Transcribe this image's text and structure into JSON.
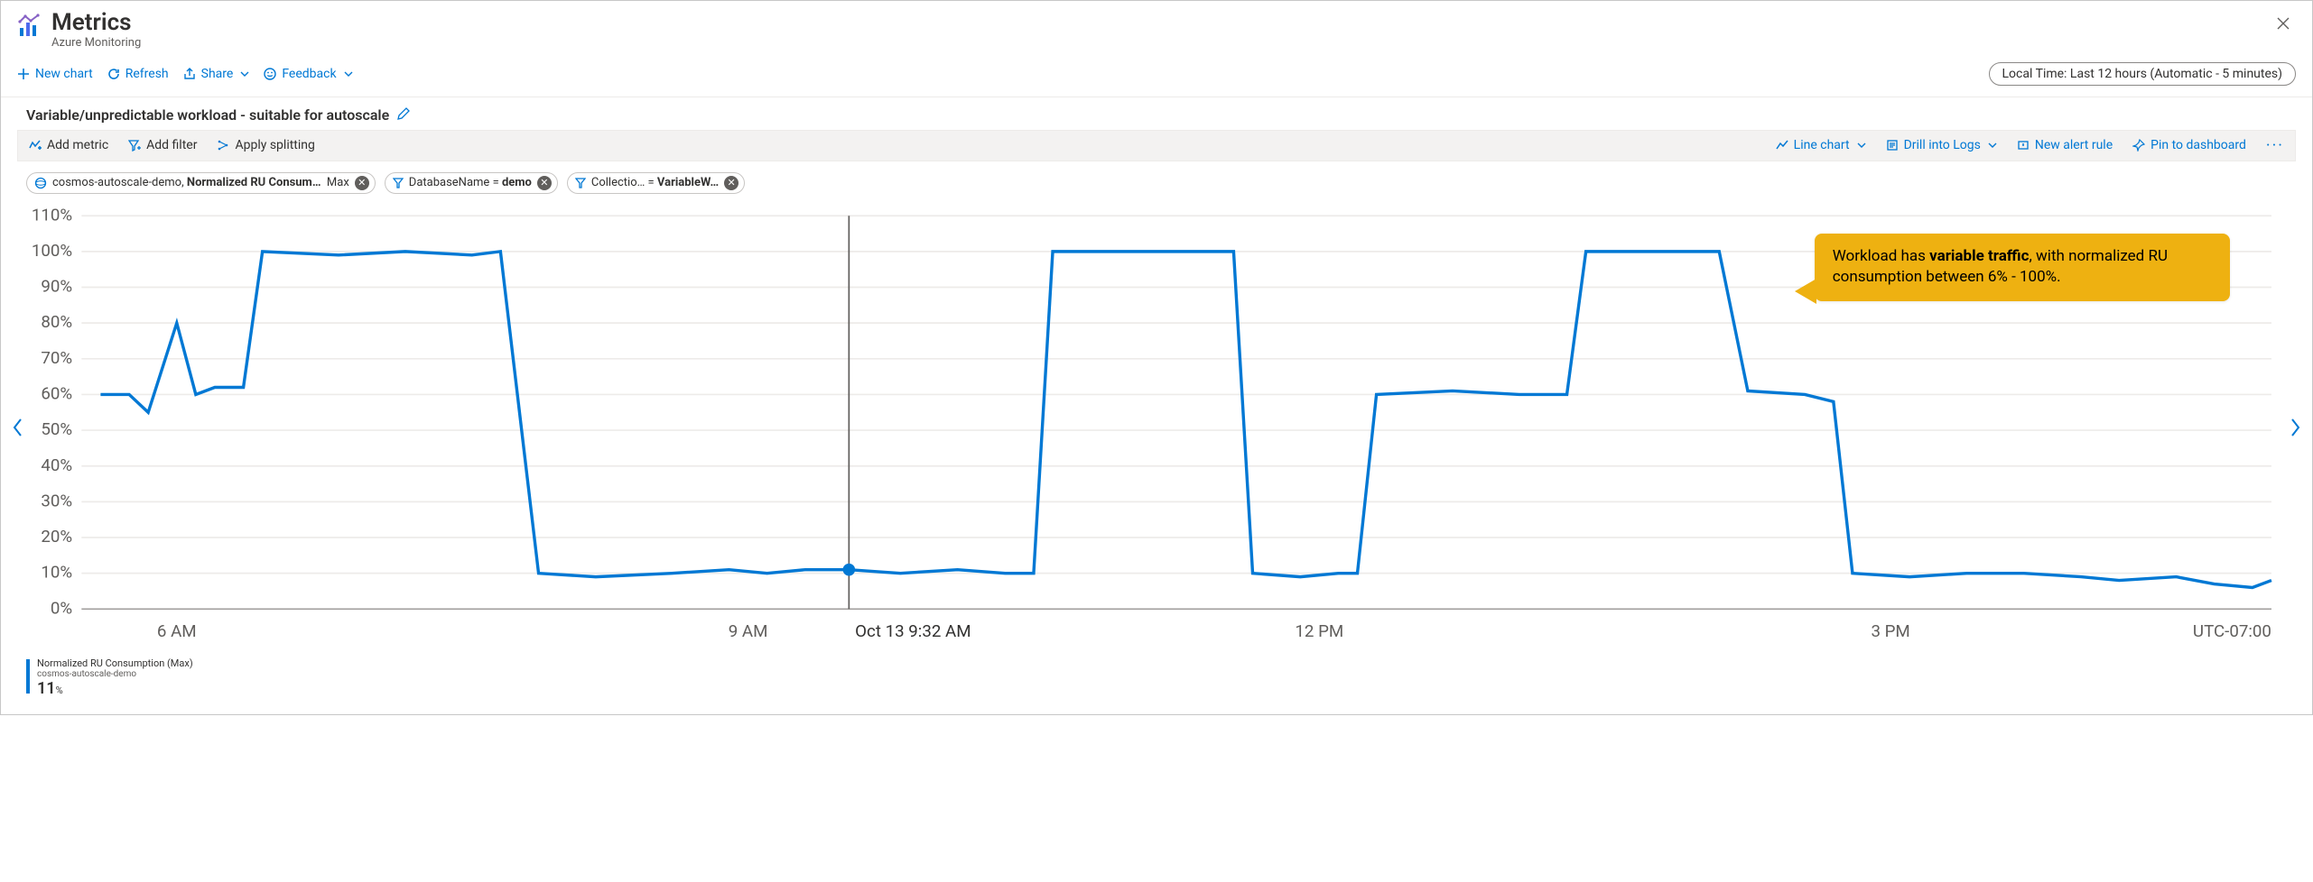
{
  "header": {
    "title": "Metrics",
    "subtitle": "Azure Monitoring"
  },
  "toolbar": {
    "new_chart": "New chart",
    "refresh": "Refresh",
    "share": "Share",
    "feedback": "Feedback",
    "time_range": "Local Time: Last 12 hours (Automatic - 5 minutes)"
  },
  "chart_title": "Variable/unpredictable workload - suitable for autoscale",
  "config_bar": {
    "add_metric": "Add metric",
    "add_filter": "Add filter",
    "apply_splitting": "Apply splitting",
    "chart_type": "Line chart",
    "drill_logs": "Drill into Logs",
    "new_alert": "New alert rule",
    "pin": "Pin to dashboard"
  },
  "chips": {
    "metric": {
      "resource": "cosmos-autoscale-demo,",
      "metric_name": "Normalized RU Consum…",
      "agg": "Max"
    },
    "filter_db": {
      "key": "DatabaseName",
      "eq": "=",
      "val": "demo"
    },
    "filter_coll": {
      "key": "Collectio…",
      "eq": "=",
      "val": "VariableW…"
    }
  },
  "chart_data": {
    "type": "line",
    "title": "Variable/unpredictable workload - suitable for autoscale",
    "ylabel": "Normalized RU Consumption (Max) %",
    "ylim": [
      0,
      110
    ],
    "y_ticks": [
      "0%",
      "10%",
      "20%",
      "30%",
      "40%",
      "50%",
      "60%",
      "70%",
      "80%",
      "90%",
      "100%",
      "110%"
    ],
    "x_range_hours": [
      5.5,
      17
    ],
    "x_ticks": [
      {
        "h": 6,
        "label": "6 AM"
      },
      {
        "h": 9,
        "label": "9 AM"
      },
      {
        "h": 12,
        "label": "12 PM"
      },
      {
        "h": 15,
        "label": "3 PM"
      }
    ],
    "cursor": {
      "h": 9.53,
      "label": "Oct 13 9:32 AM"
    },
    "timezone_label": "UTC-07:00",
    "series": [
      {
        "name": "Normalized RU Consumption (Max)",
        "resource": "cosmos-autoscale-demo",
        "color": "#0078d4",
        "points": [
          [
            5.6,
            60
          ],
          [
            5.75,
            60
          ],
          [
            5.85,
            55
          ],
          [
            6.0,
            80
          ],
          [
            6.1,
            60
          ],
          [
            6.2,
            62
          ],
          [
            6.35,
            62
          ],
          [
            6.45,
            100
          ],
          [
            6.85,
            99
          ],
          [
            7.2,
            100
          ],
          [
            7.55,
            99
          ],
          [
            7.7,
            100
          ],
          [
            7.9,
            10
          ],
          [
            8.2,
            9
          ],
          [
            8.6,
            10
          ],
          [
            8.9,
            11
          ],
          [
            9.1,
            10
          ],
          [
            9.3,
            11
          ],
          [
            9.53,
            11
          ],
          [
            9.8,
            10
          ],
          [
            10.1,
            11
          ],
          [
            10.35,
            10
          ],
          [
            10.5,
            10
          ],
          [
            10.6,
            100
          ],
          [
            10.95,
            100
          ],
          [
            11.25,
            100
          ],
          [
            11.55,
            100
          ],
          [
            11.65,
            10
          ],
          [
            11.9,
            9
          ],
          [
            12.1,
            10
          ],
          [
            12.2,
            10
          ],
          [
            12.3,
            60
          ],
          [
            12.7,
            61
          ],
          [
            13.05,
            60
          ],
          [
            13.3,
            60
          ],
          [
            13.4,
            100
          ],
          [
            13.75,
            100
          ],
          [
            14.1,
            100
          ],
          [
            14.25,
            61
          ],
          [
            14.55,
            60
          ],
          [
            14.7,
            58
          ],
          [
            14.8,
            10
          ],
          [
            15.1,
            9
          ],
          [
            15.4,
            10
          ],
          [
            15.7,
            10
          ],
          [
            16.0,
            9
          ],
          [
            16.2,
            8
          ],
          [
            16.5,
            9
          ],
          [
            16.7,
            7
          ],
          [
            16.9,
            6
          ],
          [
            17.0,
            8
          ]
        ]
      }
    ]
  },
  "callout": {
    "prefix": "Workload has ",
    "bold": "variable traffic",
    "suffix": ", with normalized RU consumption between 6% - 100%."
  },
  "legend": {
    "line1": "Normalized RU Consumption (Max)",
    "line2": "cosmos-autoscale-demo",
    "value": "11",
    "unit": "%"
  }
}
